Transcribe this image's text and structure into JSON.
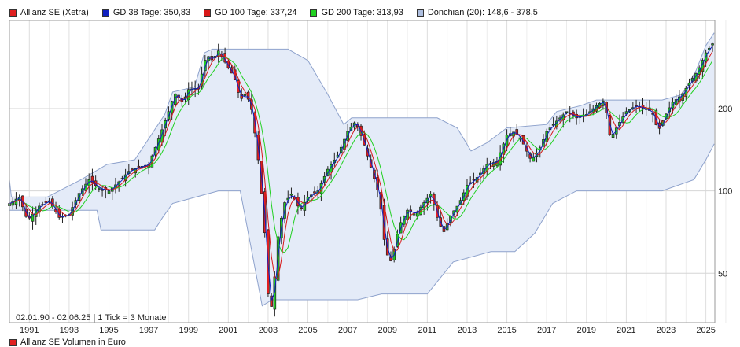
{
  "legend": [
    {
      "label": "Allianz SE (Xetra)",
      "color": "#e02020"
    },
    {
      "label": "GD 38 Tage: 350,83",
      "color": "#1020c0"
    },
    {
      "label": "GD 100 Tage: 337,24",
      "color": "#d81818"
    },
    {
      "label": "GD 200 Tage: 313,93",
      "color": "#20d020"
    },
    {
      "label": "Donchian (20): 148,6 - 378,5",
      "color": "#aebfe0"
    }
  ],
  "info_text": "02.01.90 - 02.06.25 | 1 Tick = 3 Monate",
  "footer_label": "Allianz SE Volumen in Euro",
  "chart_data": {
    "type": "candlestick",
    "y_scale": "log",
    "ylim": [
      33,
      420
    ],
    "y_ticks": [
      50,
      100,
      200
    ],
    "x_range": [
      1990.0,
      2025.45
    ],
    "x_ticks": [
      "1991",
      "1993",
      "1995",
      "1997",
      "1999",
      "2001",
      "2003",
      "2005",
      "2007",
      "2009",
      "2011",
      "2013",
      "2015",
      "2017",
      "2019",
      "2021",
      "2023",
      "2025"
    ],
    "colors": {
      "up": "#22cc22",
      "down": "#e02020",
      "band_fill": "#e4ebf8",
      "band_line": "#8ea2cc",
      "gd38": "#1020c0",
      "gd100": "#d81818",
      "gd200": "#20d020"
    },
    "close_anchors": [
      [
        1990.0,
        90
      ],
      [
        1990.5,
        95
      ],
      [
        1990.9,
        78
      ],
      [
        1991.5,
        88
      ],
      [
        1992.0,
        92
      ],
      [
        1992.5,
        80
      ],
      [
        1993.0,
        82
      ],
      [
        1993.5,
        98
      ],
      [
        1994.0,
        110
      ],
      [
        1994.5,
        102
      ],
      [
        1995.0,
        100
      ],
      [
        1995.5,
        108
      ],
      [
        1996.0,
        118
      ],
      [
        1996.5,
        122
      ],
      [
        1997.0,
        125
      ],
      [
        1997.5,
        155
      ],
      [
        1998.0,
        195
      ],
      [
        1998.3,
        228
      ],
      [
        1998.7,
        210
      ],
      [
        1999.0,
        235
      ],
      [
        1999.5,
        238
      ],
      [
        1999.9,
        315
      ],
      [
        2000.2,
        300
      ],
      [
        2000.5,
        325
      ],
      [
        2000.9,
        290
      ],
      [
        2001.3,
        260
      ],
      [
        2001.6,
        215
      ],
      [
        2001.9,
        228
      ],
      [
        2002.2,
        195
      ],
      [
        2002.5,
        130
      ],
      [
        2002.8,
        78
      ],
      [
        2003.0,
        42
      ],
      [
        2003.2,
        37
      ],
      [
        2003.5,
        68
      ],
      [
        2003.8,
        90
      ],
      [
        2004.2,
        98
      ],
      [
        2004.6,
        85
      ],
      [
        2005.0,
        95
      ],
      [
        2005.5,
        100
      ],
      [
        2006.0,
        120
      ],
      [
        2006.5,
        135
      ],
      [
        2007.0,
        165
      ],
      [
        2007.4,
        180
      ],
      [
        2007.8,
        150
      ],
      [
        2008.2,
        120
      ],
      [
        2008.6,
        95
      ],
      [
        2008.9,
        60
      ],
      [
        2009.2,
        55
      ],
      [
        2009.6,
        75
      ],
      [
        2010.0,
        85
      ],
      [
        2010.4,
        82
      ],
      [
        2010.8,
        90
      ],
      [
        2011.2,
        98
      ],
      [
        2011.5,
        80
      ],
      [
        2011.8,
        70
      ],
      [
        2012.2,
        82
      ],
      [
        2012.6,
        90
      ],
      [
        2013.0,
        105
      ],
      [
        2013.5,
        112
      ],
      [
        2014.0,
        125
      ],
      [
        2014.5,
        128
      ],
      [
        2015.0,
        160
      ],
      [
        2015.4,
        165
      ],
      [
        2015.8,
        150
      ],
      [
        2016.2,
        130
      ],
      [
        2016.6,
        140
      ],
      [
        2017.0,
        165
      ],
      [
        2017.5,
        180
      ],
      [
        2018.0,
        195
      ],
      [
        2018.5,
        185
      ],
      [
        2019.0,
        190
      ],
      [
        2019.5,
        205
      ],
      [
        2019.9,
        215
      ],
      [
        2020.2,
        155
      ],
      [
        2020.6,
        175
      ],
      [
        2021.0,
        195
      ],
      [
        2021.5,
        205
      ],
      [
        2021.9,
        200
      ],
      [
        2022.3,
        195
      ],
      [
        2022.6,
        165
      ],
      [
        2022.9,
        185
      ],
      [
        2023.3,
        210
      ],
      [
        2023.8,
        225
      ],
      [
        2024.2,
        250
      ],
      [
        2024.6,
        275
      ],
      [
        2025.0,
        320
      ],
      [
        2025.42,
        352
      ]
    ],
    "donchian": {
      "upper": [
        [
          1990.0,
          110
        ],
        [
          1990.1,
          95
        ],
        [
          1991.9,
          95
        ],
        [
          1993.6,
          110
        ],
        [
          1994.9,
          125
        ],
        [
          1996.3,
          130
        ],
        [
          1997.8,
          190
        ],
        [
          1998.2,
          230
        ],
        [
          1999.3,
          240
        ],
        [
          1999.8,
          320
        ],
        [
          2000.2,
          330
        ],
        [
          2004.0,
          330
        ],
        [
          2005.0,
          300
        ],
        [
          2006.0,
          225
        ],
        [
          2006.8,
          175
        ],
        [
          2007.2,
          185
        ],
        [
          2011.5,
          185
        ],
        [
          2012.5,
          170
        ],
        [
          2013.2,
          140
        ],
        [
          2014.0,
          150
        ],
        [
          2015.0,
          170
        ],
        [
          2017.0,
          175
        ],
        [
          2017.5,
          195
        ],
        [
          2018.7,
          205
        ],
        [
          2019.5,
          215
        ],
        [
          2022.8,
          215
        ],
        [
          2023.8,
          225
        ],
        [
          2024.5,
          275
        ],
        [
          2025.0,
          340
        ],
        [
          2025.42,
          378.5
        ]
      ],
      "lower": [
        [
          1990.0,
          85
        ],
        [
          1994.4,
          85
        ],
        [
          1994.6,
          72
        ],
        [
          1997.3,
          72
        ],
        [
          1997.7,
          80
        ],
        [
          1998.2,
          90
        ],
        [
          2000.5,
          100
        ],
        [
          2001.6,
          100
        ],
        [
          2002.7,
          38
        ],
        [
          2003.2,
          40
        ],
        [
          2007.5,
          40
        ],
        [
          2008.7,
          42
        ],
        [
          2011.0,
          42
        ],
        [
          2012.3,
          55
        ],
        [
          2014.2,
          60
        ],
        [
          2015.4,
          60
        ],
        [
          2016.4,
          70
        ],
        [
          2017.3,
          90
        ],
        [
          2018.5,
          100
        ],
        [
          2022.8,
          100
        ],
        [
          2024.4,
          110
        ],
        [
          2025.0,
          130
        ],
        [
          2025.42,
          148.6
        ]
      ]
    }
  }
}
